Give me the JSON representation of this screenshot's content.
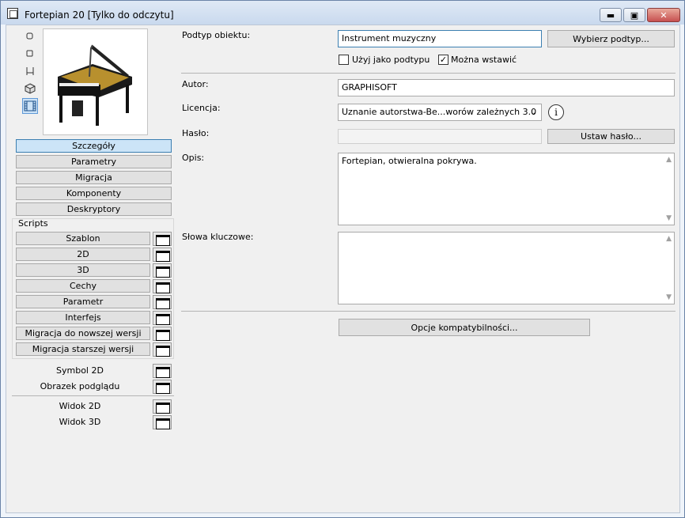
{
  "window": {
    "title": "Fortepian 20 [Tylko do odczytu]",
    "controls": {
      "minimize": "▬",
      "maximize": "▣",
      "close": "✕"
    }
  },
  "left": {
    "tools": [
      "small-square-icon",
      "small-square-outline-icon",
      "chair-icon",
      "cube-icon",
      "film-strip-icon"
    ],
    "preview_alt": "grand piano preview",
    "nav": [
      "Szczegóły",
      "Parametry",
      "Migracja",
      "Komponenty",
      "Deskryptory"
    ],
    "scripts_group_label": "Scripts",
    "scripts": [
      "Szablon",
      "2D",
      "3D",
      "Cechy",
      "Parametr",
      "Interfejs",
      "Migracja do nowszej wersji",
      "Migracja starszej wersji"
    ],
    "extras_a": [
      "Symbol 2D",
      "Obrazek podglądu"
    ],
    "extras_b": [
      "Widok 2D",
      "Widok 3D"
    ]
  },
  "form": {
    "subtype_label": "Podtyp obiektu:",
    "subtype_value": "Instrument muzyczny",
    "subtype_button": "Wybierz podtyp...",
    "use_as_subtype_label": "Użyj jako podtypu",
    "use_as_subtype_checked": false,
    "can_place_label": "Można wstawić",
    "can_place_checked": true,
    "author_label": "Autor:",
    "author_value": "GRAPHISOFT",
    "license_label": "Licencja:",
    "license_value": "Uznanie autorstwa-Be...worów zależnych 3.0",
    "password_label": "Hasło:",
    "password_value": "",
    "password_button": "Ustaw hasło...",
    "description_label": "Opis:",
    "description_value": "Fortepian, otwieralna pokrywa.",
    "keywords_label": "Słowa kluczowe:",
    "keywords_value": "",
    "compat_button": "Opcje kompatybilności..."
  },
  "colors": {
    "accent": "#3c7fb1",
    "active_nav": "#cce4f7",
    "panel": "#f0f0f0"
  }
}
